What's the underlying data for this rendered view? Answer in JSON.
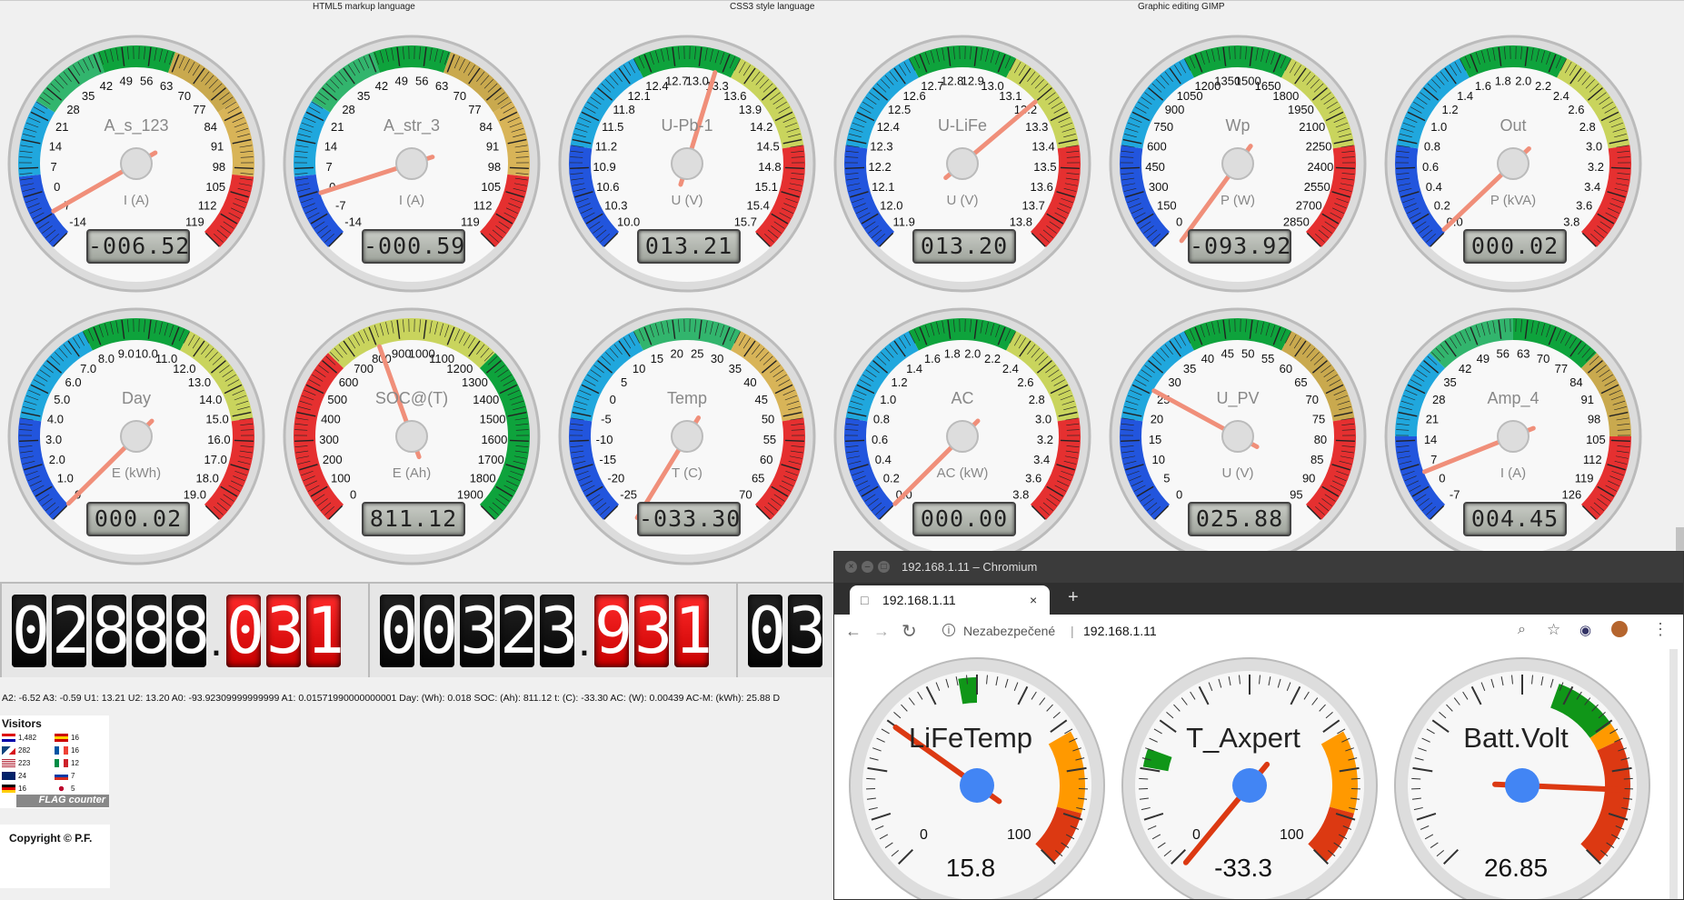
{
  "page": {
    "top_links": [
      "HTML5 markup language",
      "CSS3 style language",
      "Graphic editing GIMP"
    ],
    "status_line": "A2: -6.52 A3: -0.59 U1: 13.21 U2: 13.20 A0: -93.92309999999999 A1: 0.01571990000000001 Day: (Wh): 0.018 SOC: (Ah): 811.12 t: (C): -33.30 AC: (W): 0.00439 AC-M: (kWh): 25.88 D"
  },
  "colors": {
    "background": "#f0f0f0",
    "needle": "#f08f7a",
    "window_bar": "#3b3b3b",
    "google_gauge_blue": "#4285f4",
    "green": "#109618",
    "orange": "#ff9900",
    "red": "#dc3912"
  },
  "gauges": [
    {
      "title": "A_s_123",
      "unit": "I (A)",
      "ticks": [
        "-14",
        "-7",
        "0",
        "7",
        "14",
        "21",
        "28",
        "35",
        "42",
        "49",
        "56",
        "63",
        "70",
        "77",
        "84",
        "91",
        "98",
        "105",
        "112",
        "119"
      ],
      "lcd": "-006.52",
      "min": -14,
      "max": 119,
      "value": -6.52,
      "segments": [
        "#2255dd",
        "#20a7dd",
        "#32b56d",
        "#0ea33c",
        "#c9a94e",
        "#d8b458",
        "#e53030"
      ]
    },
    {
      "title": "A_str_3",
      "unit": "I (A)",
      "ticks": [
        "-14",
        "-7",
        "0",
        "7",
        "14",
        "21",
        "28",
        "35",
        "42",
        "49",
        "56",
        "63",
        "70",
        "77",
        "84",
        "91",
        "98",
        "105",
        "112",
        "119"
      ],
      "lcd": "-000.59",
      "min": -14,
      "max": 119,
      "value": -0.59,
      "segments": [
        "#2255dd",
        "#20a7dd",
        "#32b56d",
        "#0ea33c",
        "#c9a94e",
        "#d8b458",
        "#e53030"
      ]
    },
    {
      "title": "U-Pb-1",
      "unit": "U (V)",
      "ticks": [
        "10.0",
        "10.3",
        "10.6",
        "10.9",
        "11.2",
        "11.5",
        "11.8",
        "12.1",
        "12.4",
        "12.7",
        "13.0",
        "13.3",
        "13.6",
        "13.9",
        "14.2",
        "14.5",
        "14.8",
        "15.1",
        "15.4",
        "15.7"
      ],
      "lcd": "013.21",
      "min": 10,
      "max": 15.7,
      "value": 13.21,
      "segments": [
        "#2255dd",
        "#20a7dd",
        "#0ea33c",
        "#c9d45d",
        "#e53030"
      ]
    },
    {
      "title": "U-LiFe",
      "unit": "U (V)",
      "ticks": [
        "11.9",
        "12.0",
        "12.1",
        "12.2",
        "12.3",
        "12.4",
        "12.5",
        "12.6",
        "12.7",
        "12.8",
        "12.9",
        "13.0",
        "13.1",
        "13.2",
        "13.3",
        "13.4",
        "13.5",
        "13.6",
        "13.7",
        "13.8"
      ],
      "lcd": "013.20",
      "min": 11.9,
      "max": 13.8,
      "value": 13.2,
      "segments": [
        "#2255dd",
        "#20a7dd",
        "#0ea33c",
        "#c9d45d",
        "#e53030"
      ]
    },
    {
      "title": "Wp",
      "unit": "P (W)",
      "ticks": [
        "0",
        "150",
        "300",
        "450",
        "600",
        "750",
        "900",
        "1050",
        "1200",
        "1350",
        "1500",
        "1650",
        "1800",
        "1950",
        "2100",
        "2250",
        "2400",
        "2550",
        "2700",
        "2850"
      ],
      "lcd": "-093.92",
      "min": 0,
      "max": 2850,
      "value": -93.92,
      "segments": [
        "#2255dd",
        "#20a7dd",
        "#0ea33c",
        "#c9d45d",
        "#e53030"
      ]
    },
    {
      "title": "Out",
      "unit": "P (kVA)",
      "ticks": [
        "0.0",
        "0.2",
        "0.4",
        "0.6",
        "0.8",
        "1.0",
        "1.2",
        "1.4",
        "1.6",
        "1.8",
        "2.0",
        "2.2",
        "2.4",
        "2.6",
        "2.8",
        "3.0",
        "3.2",
        "3.4",
        "3.6",
        "3.8"
      ],
      "lcd": "000.02",
      "min": 0,
      "max": 3.8,
      "value": 0.02,
      "segments": [
        "#2255dd",
        "#20a7dd",
        "#0ea33c",
        "#c9d45d",
        "#e53030"
      ]
    },
    {
      "title": "Day",
      "unit": "E (kWh)",
      "ticks": [
        "0",
        "1.0",
        "2.0",
        "3.0",
        "4.0",
        "5.0",
        "6.0",
        "7.0",
        "8.0",
        "9.0",
        "10.0",
        "11.0",
        "12.0",
        "13.0",
        "14.0",
        "15.0",
        "16.0",
        "17.0",
        "18.0",
        "19.0"
      ],
      "lcd": "000.02",
      "min": 0,
      "max": 19,
      "value": 0.02,
      "segments": [
        "#2255dd",
        "#20a7dd",
        "#0ea33c",
        "#c9d45d",
        "#e53030"
      ]
    },
    {
      "title": "SOC@(T)",
      "unit": "E (Ah)",
      "ticks": [
        "0",
        "100",
        "200",
        "300",
        "400",
        "500",
        "600",
        "700",
        "800",
        "900",
        "1000",
        "1100",
        "1200",
        "1300",
        "1400",
        "1500",
        "1600",
        "1700",
        "1800",
        "1900"
      ],
      "lcd": "811.12",
      "min": 0,
      "max": 1900,
      "value": 811.12,
      "segments": [
        "#e53030",
        "#c9d45d",
        "#0ea33c"
      ]
    },
    {
      "title": "Temp",
      "unit": "T (C)",
      "ticks": [
        "-25",
        "-20",
        "-15",
        "-10",
        "-5",
        "0",
        "5",
        "10",
        "15",
        "20",
        "25",
        "30",
        "35",
        "40",
        "45",
        "50",
        "55",
        "60",
        "65",
        "70"
      ],
      "lcd": "-033.30",
      "min": -25,
      "max": 70,
      "value": -33.3,
      "segments": [
        "#2255dd",
        "#20a7dd",
        "#32b56d",
        "#d8b458",
        "#e53030"
      ]
    },
    {
      "title": "AC",
      "unit": "AC (kW)",
      "ticks": [
        "0.0",
        "0.2",
        "0.4",
        "0.6",
        "0.8",
        "1.0",
        "1.2",
        "1.4",
        "1.6",
        "1.8",
        "2.0",
        "2.2",
        "2.4",
        "2.6",
        "2.8",
        "3.0",
        "3.2",
        "3.4",
        "3.6",
        "3.8"
      ],
      "lcd": "000.00",
      "min": 0,
      "max": 3.8,
      "value": 0,
      "segments": [
        "#2255dd",
        "#20a7dd",
        "#0ea33c",
        "#c9d45d",
        "#e53030"
      ]
    },
    {
      "title": "U_PV",
      "unit": "U (V)",
      "ticks": [
        "0",
        "5",
        "10",
        "15",
        "20",
        "25",
        "30",
        "35",
        "40",
        "45",
        "50",
        "55",
        "60",
        "65",
        "70",
        "75",
        "80",
        "85",
        "90",
        "95"
      ],
      "lcd": "025.88",
      "min": 0,
      "max": 95,
      "value": 25.88,
      "segments": [
        "#2255dd",
        "#20a7dd",
        "#0ea33c",
        "#c9a94e",
        "#e53030"
      ]
    },
    {
      "title": "Amp_4",
      "unit": "I (A)",
      "ticks": [
        "-7",
        "0",
        "7",
        "14",
        "21",
        "28",
        "35",
        "42",
        "49",
        "56",
        "63",
        "70",
        "77",
        "84",
        "91",
        "98",
        "105",
        "112",
        "119",
        "126"
      ],
      "lcd": "004.45",
      "min": -7,
      "max": 126,
      "value": 4.45,
      "segments": [
        "#2255dd",
        "#20a7dd",
        "#32b56d",
        "#0ea33c",
        "#c9a94e",
        "#e53030"
      ]
    }
  ],
  "counters": [
    {
      "digits": [
        "0",
        "2",
        "8",
        "8",
        "8"
      ],
      "red_digits": [
        "0",
        "3",
        "1"
      ]
    },
    {
      "digits": [
        "0",
        "0",
        "3",
        "2",
        "3"
      ],
      "red_digits": [
        "9",
        "3",
        "1"
      ]
    },
    {
      "digits": [
        "0",
        "3"
      ],
      "red_digits": []
    }
  ],
  "visitors": {
    "title": "Visitors",
    "rows": [
      {
        "count": "1,482",
        "flag": "US-like",
        "right": "16"
      },
      {
        "count": "282",
        "flag": "CZ",
        "right": "16"
      },
      {
        "count": "223",
        "flag": "US",
        "right": "12"
      },
      {
        "count": "24",
        "flag": "UK",
        "right": "7"
      },
      {
        "count": "16",
        "flag": "DE",
        "right": "5"
      }
    ],
    "badge": "FLAG counter"
  },
  "copyright": "Copyright © P.F.",
  "browser": {
    "window_title": "192.168.1.11 – Chromium",
    "tab_title": "192.168.1.11",
    "security_text": "Nezabezpečené",
    "address": "192.168.1.11",
    "gauges": [
      {
        "title": "LiFeTemp",
        "value": "15.8",
        "min_label": "0",
        "max_label": "100",
        "numeric": 15.8
      },
      {
        "title": "T_Axpert",
        "value": "-33.3",
        "min_label": "0",
        "max_label": "100",
        "numeric": -33.3
      },
      {
        "title": "Batt.Volt",
        "value": "26.85",
        "min_label": "",
        "max_label": "",
        "numeric": 26.85
      }
    ]
  },
  "icons": {
    "page": "page-icon",
    "close": "close-icon",
    "new_tab": "plus-icon",
    "back": "back-arrow-icon",
    "forward": "forward-arrow-icon",
    "reload": "reload-icon",
    "info": "info-icon",
    "zoom": "zoom-icon",
    "star": "star-icon",
    "menu": "menu-icon"
  }
}
